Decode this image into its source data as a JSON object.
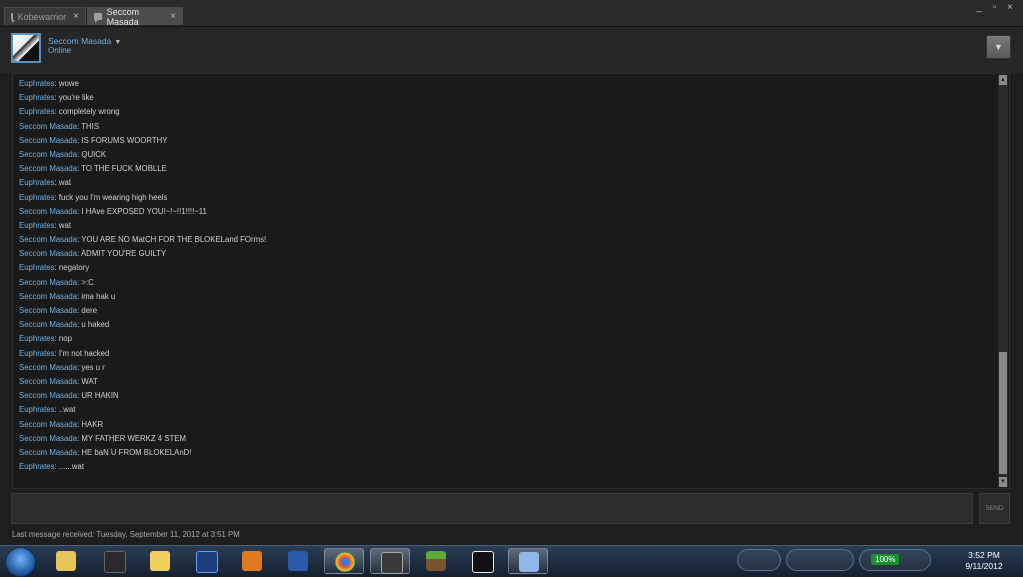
{
  "tabs": [
    {
      "label": "Kobewarrior",
      "close": "×"
    },
    {
      "label": "Seccom Masada",
      "close": "×"
    }
  ],
  "window_controls": "_ ▫ ×",
  "header": {
    "user_name": "Seccom Masada",
    "status": "Online"
  },
  "messages": [
    {
      "name": "Euphrates",
      "text": "wowe"
    },
    {
      "name": "Euphrates",
      "text": "you're like"
    },
    {
      "name": "Euphrates",
      "text": "completely wrong"
    },
    {
      "name": "Seccom Masada",
      "text": "THIS"
    },
    {
      "name": "Seccom Masada",
      "text": "IS FORUMS WOORTHY"
    },
    {
      "name": "Seccom Masada",
      "text": "QUICK"
    },
    {
      "name": "Seccom Masada",
      "text": "TO THE FUCK MOBLLE"
    },
    {
      "name": "Euphrates",
      "text": "wat"
    },
    {
      "name": "Euphrates",
      "text": "fuck you I'm wearing high heels"
    },
    {
      "name": "Seccom Masada",
      "text": "I HAve EXPOSED YOU!~!~!!1!!!!~11"
    },
    {
      "name": "Euphrates",
      "text": "wat"
    },
    {
      "name": "Seccom Masada",
      "text": "YOU ARE NO MatCH FOR THE BLOKELand FOrms!"
    },
    {
      "name": "Seccom Masada",
      "text": "ADMIT YOU'RE GUILTY"
    },
    {
      "name": "Euphrates",
      "text": "negatory"
    },
    {
      "name": "Seccom Masada",
      "text": ">:C"
    },
    {
      "name": "Seccom Masada",
      "text": "ima hak u"
    },
    {
      "name": "Seccom Masada",
      "text": "dere"
    },
    {
      "name": "Seccom Masada",
      "text": "u haked"
    },
    {
      "name": "Euphrates",
      "text": "nop"
    },
    {
      "name": "Euphrates",
      "text": "I'm not hacked"
    },
    {
      "name": "Seccom Masada",
      "text": "yes u r"
    },
    {
      "name": "Seccom Masada",
      "text": "WAT"
    },
    {
      "name": "Seccom Masada",
      "text": "UR HAKIN"
    },
    {
      "name": "Euphrates",
      "text": "..wat"
    },
    {
      "name": "Seccom Masada",
      "text": "HAKR"
    },
    {
      "name": "Seccom Masada",
      "text": "MY FATHER WERKZ 4 STEM"
    },
    {
      "name": "Seccom Masada",
      "text": "HE baN U FROM BLOKELAnD!"
    },
    {
      "name": "Euphrates",
      "text": "......wat"
    }
  ],
  "send_label": "SEND",
  "last_message": "Last message received: Tuesday, September 11, 2012 at 3:51 PM",
  "taskbar": {
    "battery": "100%",
    "time": "3:52 PM",
    "date": "9/11/2012"
  }
}
